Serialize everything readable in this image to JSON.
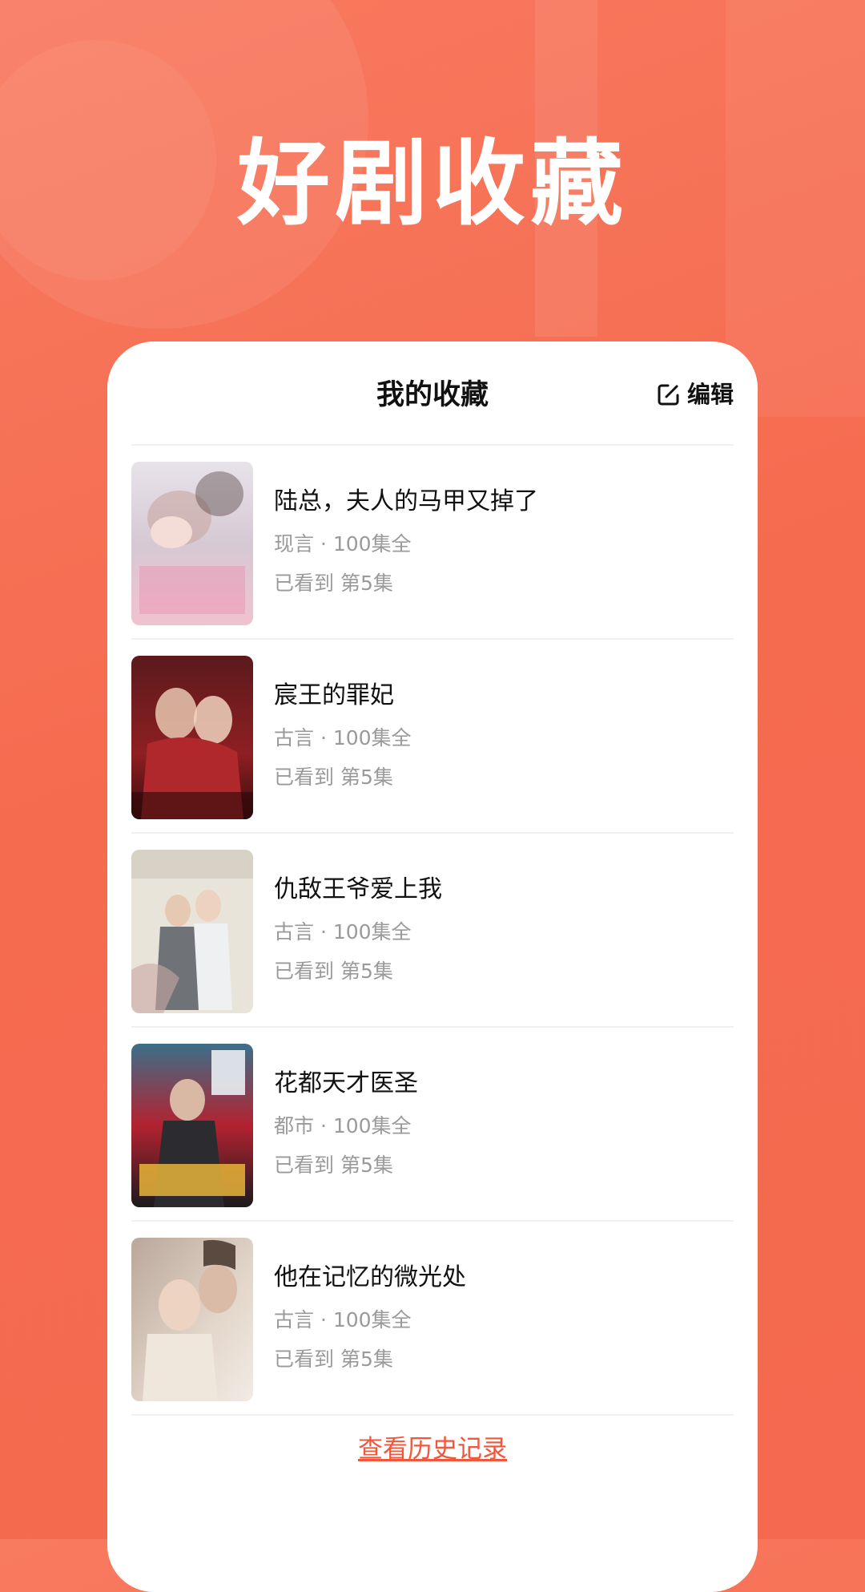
{
  "colors": {
    "background": "#f56b50",
    "accent": "#f0573c",
    "card": "#ffffff",
    "title_text": "#111111",
    "secondary_text": "#9a9a9a"
  },
  "headline": "好剧收藏",
  "card": {
    "title": "我的收藏",
    "edit_icon": "edit-icon",
    "edit_label": "编辑"
  },
  "items": [
    {
      "title": "陆总，夫人的马甲又掉了",
      "meta": "现言 · 100集全",
      "progress": "已看到 第5集"
    },
    {
      "title": "宸王的罪妃",
      "meta": "古言 · 100集全",
      "progress": "已看到 第5集"
    },
    {
      "title": "仇敌王爷爱上我",
      "meta": "古言 · 100集全",
      "progress": "已看到 第5集"
    },
    {
      "title": "花都天才医圣",
      "meta": "都市 · 100集全",
      "progress": "已看到 第5集"
    },
    {
      "title": "他在记忆的微光处",
      "meta": "古言 · 100集全",
      "progress": "已看到 第5集"
    }
  ],
  "footer": {
    "history_label": "查看历史记录"
  }
}
